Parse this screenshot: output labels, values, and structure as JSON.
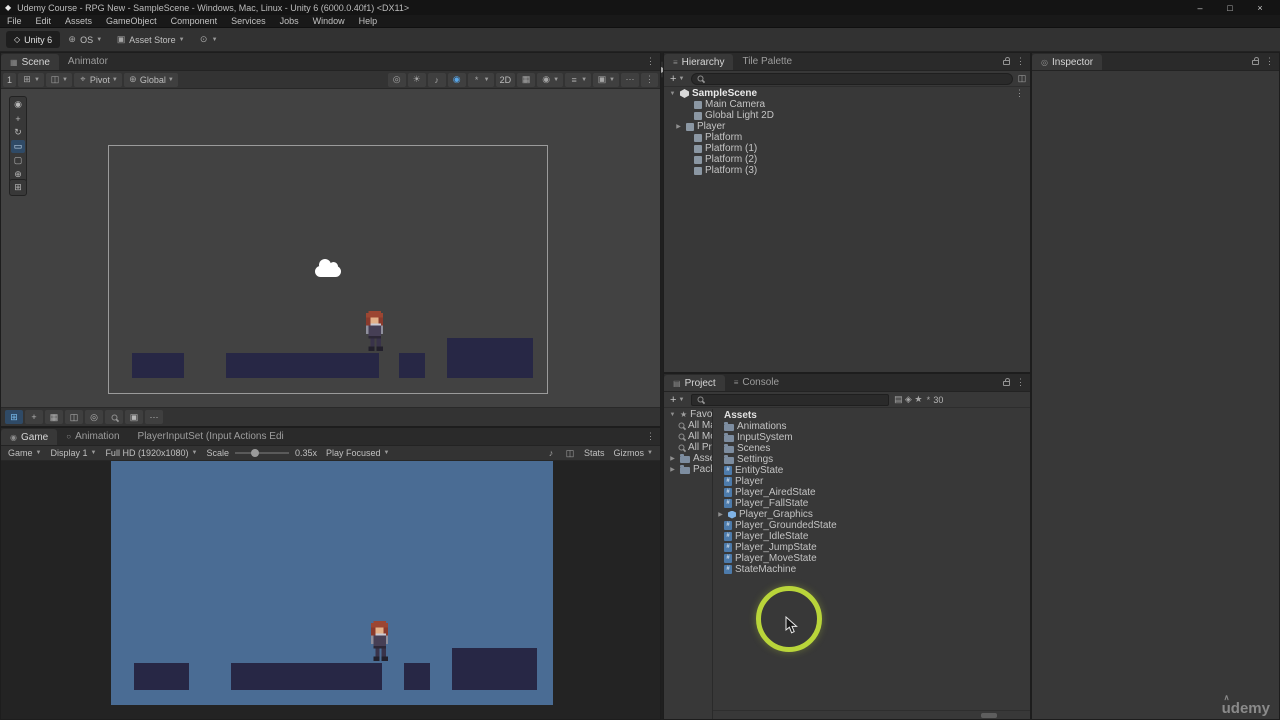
{
  "window": {
    "title": "Udemy Course - RPG New - SampleScene - Windows, Mac, Linux - Unity 6 (6000.0.40f1) <DX11>",
    "minimize": "–",
    "maximize": "□",
    "close": "×"
  },
  "menus": [
    "File",
    "Edit",
    "Assets",
    "GameObject",
    "Component",
    "Services",
    "Jobs",
    "Window",
    "Help"
  ],
  "toolbar": {
    "unity_version": "Unity 6",
    "os": "OS",
    "asset_store": "Asset Store",
    "layout": "Layout"
  },
  "scene_panel": {
    "tabs": [
      "Scene",
      "Animator"
    ],
    "tool_row": {
      "index": "1",
      "pivot": "Pivot",
      "global": "Global",
      "mode_2d": "2D"
    }
  },
  "game_panel": {
    "tabs": [
      "Game",
      "Animation",
      "PlayerInputSet (Input Actions Edi"
    ],
    "toolbar": {
      "game_menu": "Game",
      "display": "Display 1",
      "resolution": "Full HD (1920x1080)",
      "scale_label": "Scale",
      "scale_value": "0.35x",
      "focus_mode": "Play Focused",
      "stats": "Stats",
      "gizmos": "Gizmos"
    }
  },
  "hierarchy": {
    "tabs": [
      "Hierarchy",
      "Tile Palette"
    ],
    "scene_name": "SampleScene",
    "objects": [
      "Main Camera",
      "Global Light 2D",
      "Player",
      "Platform",
      "Platform (1)",
      "Platform (2)",
      "Platform (3)"
    ]
  },
  "inspector": {
    "tab": "Inspector"
  },
  "project": {
    "tabs": [
      "Project",
      "Console"
    ],
    "favorites_label": "Favorites",
    "favorites": [
      "All Materials",
      "All Models",
      "All Prefabs"
    ],
    "assets_label": "Assets",
    "packages_label": "Packages",
    "list_header": "Assets",
    "folders": [
      "Animations",
      "InputSystem",
      "Scenes",
      "Settings"
    ],
    "files": [
      "EntityState",
      "Player",
      "Player_AiredState",
      "Player_FallState",
      "Player_Graphics",
      "Player_GroundedState",
      "Player_IdleState",
      "Player_JumpState",
      "Player_MoveState",
      "StateMachine"
    ],
    "item_count": "30"
  },
  "watermark": "udemy",
  "colors": {
    "accent": "#b9d53a",
    "sky": "#4a6c94",
    "platform": "#272745"
  }
}
